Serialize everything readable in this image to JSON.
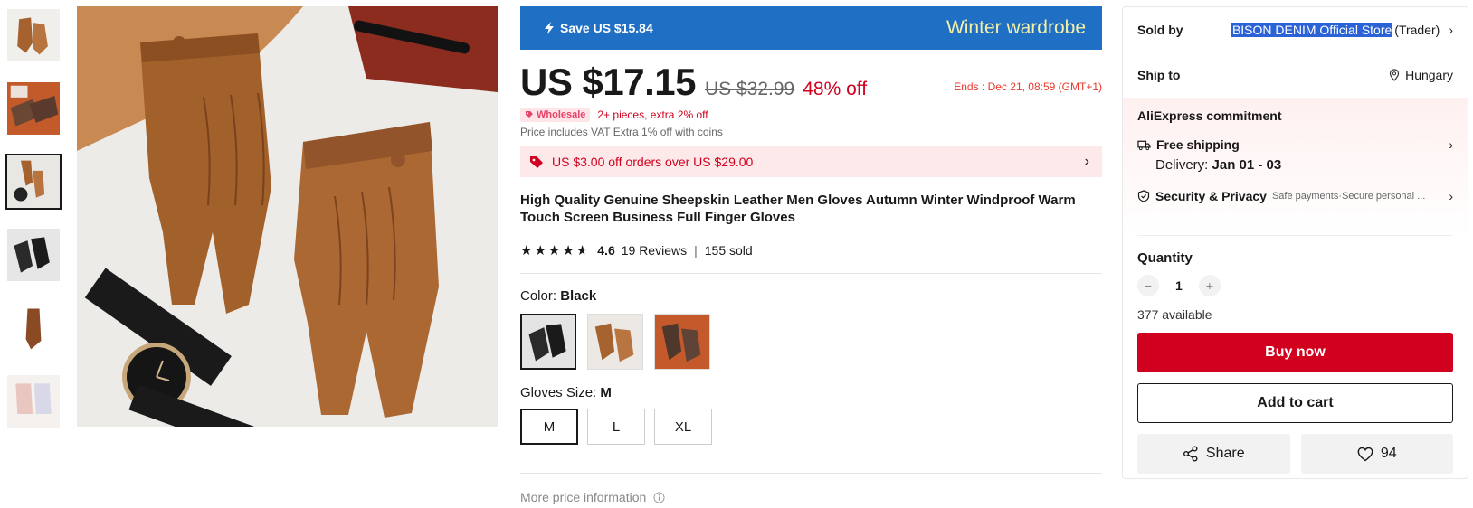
{
  "colors": {
    "accent": "#d1001e",
    "banner": "#1f6fc4",
    "highlight": "#2b62d6"
  },
  "gallery": {
    "thumbnails": [
      "thumb-1",
      "thumb-2",
      "thumb-3",
      "thumb-4",
      "thumb-5",
      "thumb-6"
    ],
    "active_index": 2
  },
  "banner": {
    "save": "Save US $15.84",
    "campaign": "Winter wardrobe",
    "icon": "lightning-icon"
  },
  "price": {
    "current": "US $17.15",
    "original": "US $32.99",
    "discount": "48% off",
    "ends": "Ends :  Dec 21, 08:59 (GMT+1)"
  },
  "wholesale": {
    "badge": "Wholesale",
    "text": "2+ pieces, extra 2% off"
  },
  "vat_note": "Price includes VAT Extra 1% off with coins",
  "coupon": {
    "text": "US $3.00 off orders over US $29.00",
    "icon": "tag-icon"
  },
  "product": {
    "title": "High Quality Genuine Sheepskin Leather Men Gloves Autumn Winter Windproof Warm Touch Screen Business Full Finger Gloves",
    "rating": "4.6",
    "rating_value": 4.6,
    "reviews": "19 Reviews",
    "sold": "155 sold"
  },
  "color": {
    "label": "Color: ",
    "selected": "Black",
    "options": [
      "Black",
      "Brown",
      "Coffee"
    ]
  },
  "size": {
    "label": "Gloves Size: ",
    "selected": "M",
    "options": [
      "M",
      "L",
      "XL"
    ]
  },
  "more_price": "More price information",
  "sidebar": {
    "sold_by_label": "Sold by",
    "store_name": "BISON DENIM Official Store",
    "store_type": "(Trader)",
    "ship_to_label": "Ship to",
    "ship_to_value": "Hungary",
    "commitment_title": "AliExpress commitment",
    "free_shipping": "Free shipping",
    "delivery_label": "Delivery: ",
    "delivery_value": "Jan 01 - 03",
    "security_title": "Security & Privacy",
    "security_sub": "Safe payments·Secure personal ...",
    "quantity_label": "Quantity",
    "quantity_value": "1",
    "available": "377 available",
    "buy_now": "Buy now",
    "add_to_cart": "Add to cart",
    "share": "Share",
    "wishlist_count": "94"
  }
}
